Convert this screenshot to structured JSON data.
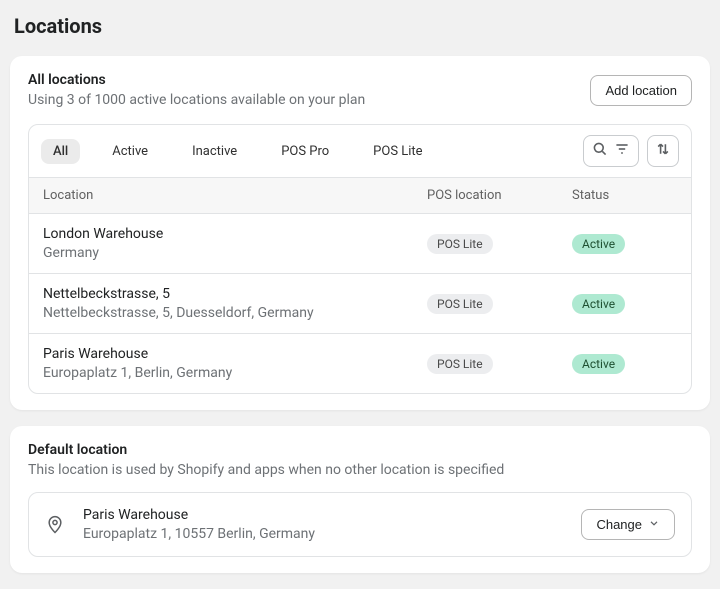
{
  "page": {
    "title": "Locations"
  },
  "allLocations": {
    "heading": "All locations",
    "subheading": "Using 3 of 1000 active locations available on your plan",
    "addButton": "Add location",
    "tabs": [
      "All",
      "Active",
      "Inactive",
      "POS Pro",
      "POS Lite"
    ],
    "columns": {
      "location": "Location",
      "pos": "POS location",
      "status": "Status"
    },
    "rows": [
      {
        "name": "London Warehouse",
        "address": "Germany",
        "pos": "POS Lite",
        "status": "Active"
      },
      {
        "name": "Nettelbeckstrasse, 5",
        "address": "Nettelbeckstrasse, 5, Duesseldorf, Germany",
        "pos": "POS Lite",
        "status": "Active"
      },
      {
        "name": "Paris Warehouse",
        "address": "Europaplatz 1, Berlin, Germany",
        "pos": "POS Lite",
        "status": "Active"
      }
    ]
  },
  "defaultLocation": {
    "heading": "Default location",
    "subheading": "This location is used by Shopify and apps when no other location is specified",
    "name": "Paris Warehouse",
    "address": "Europaplatz 1, 10557 Berlin, Germany",
    "changeButton": "Change"
  }
}
